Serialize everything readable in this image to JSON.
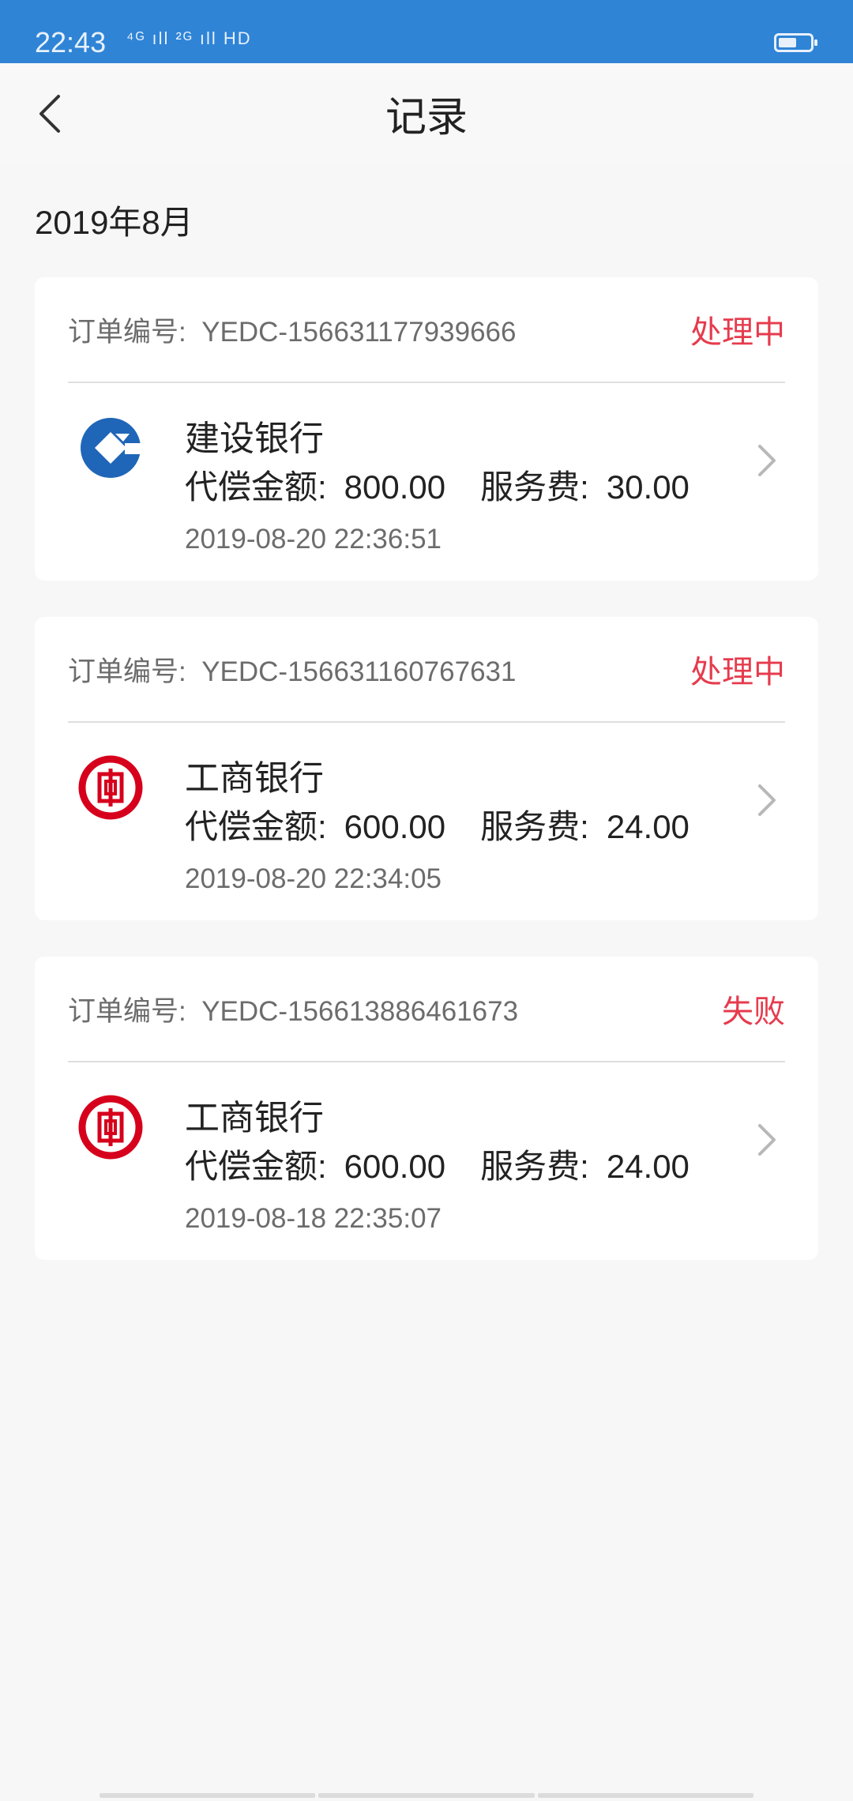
{
  "status_bar": {
    "time": "22:43",
    "signal": "⁴ᴳ ıll ²ᴳ ıll HD"
  },
  "header": {
    "title": "记录",
    "back_icon": "chevron-left-icon"
  },
  "month": "2019年8月",
  "records": [
    {
      "order_label": "订单编号:",
      "order_id": "YEDC-156631177939666",
      "status": "处理中",
      "bank": "建设银行",
      "bank_icon": "ccb-logo-icon",
      "amount_label": "代偿金额:",
      "amount": "800.00",
      "fee_label": "服务费:",
      "fee": "30.00",
      "datetime": "2019-08-20 22:36:51"
    },
    {
      "order_label": "订单编号:",
      "order_id": "YEDC-156631160767631",
      "status": "处理中",
      "bank": "工商银行",
      "bank_icon": "icbc-logo-icon",
      "amount_label": "代偿金额:",
      "amount": "600.00",
      "fee_label": "服务费:",
      "fee": "24.00",
      "datetime": "2019-08-20 22:34:05"
    },
    {
      "order_label": "订单编号:",
      "order_id": "YEDC-156613886461673",
      "status": "失败",
      "bank": "工商银行",
      "bank_icon": "icbc-logo-icon",
      "amount_label": "代偿金额:",
      "amount": "600.00",
      "fee_label": "服务费:",
      "fee": "24.00",
      "datetime": "2019-08-18 22:35:07"
    }
  ],
  "colors": {
    "status_bar": "#2f84d6",
    "status_text": "#e63b4d",
    "ccb_blue": "#1f66b8",
    "icbc_red": "#d6001c"
  }
}
